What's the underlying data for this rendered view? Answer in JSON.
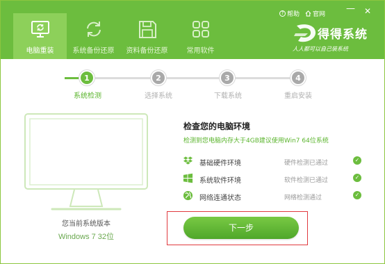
{
  "top_links": {
    "help": "帮助",
    "website": "官网"
  },
  "window_controls": {
    "minimize": "—",
    "close": "✕"
  },
  "logo": {
    "name": "得得系统",
    "slogan": "人人都可以自己装系统"
  },
  "nav": {
    "items": [
      {
        "label": "电脑重装",
        "icon": "monitor-refresh-icon",
        "active": true
      },
      {
        "label": "系统备份还原",
        "icon": "sync-icon",
        "active": false
      },
      {
        "label": "资料备份还原",
        "icon": "floppy-disk-icon",
        "active": false
      },
      {
        "label": "常用软件",
        "icon": "apps-grid-icon",
        "active": false
      }
    ]
  },
  "steps": [
    {
      "number": "1",
      "label": "系统检测",
      "state": "active"
    },
    {
      "number": "2",
      "label": "选择系统",
      "state": "pending"
    },
    {
      "number": "3",
      "label": "下载系统",
      "state": "pending"
    },
    {
      "number": "4",
      "label": "重启安装",
      "state": "pending"
    }
  ],
  "current_system": {
    "label": "您当前系统版本",
    "value": "Windows 7 32位"
  },
  "check": {
    "title": "检查您的电脑环境",
    "subtitle": "检测到您电脑内存大于4GB建议使用Win7 64位系统",
    "rows": [
      {
        "name": "基础硬件环境",
        "status": "硬件检测已通过",
        "icon": "dropbox-icon"
      },
      {
        "name": "系统软件环境",
        "status": "软件检测已通过",
        "icon": "windows-logo-icon"
      },
      {
        "name": "网络连通状态",
        "status": "网络检测通过",
        "icon": "globe-icon"
      }
    ],
    "ok_mark": "✓"
  },
  "next_button": {
    "label": "下一步"
  },
  "colors": {
    "brand_green": "#6cbd3e",
    "active_nav": "#8dd05a",
    "step_pending": "#a9a9a9",
    "highlight_red": "#e0393e"
  }
}
